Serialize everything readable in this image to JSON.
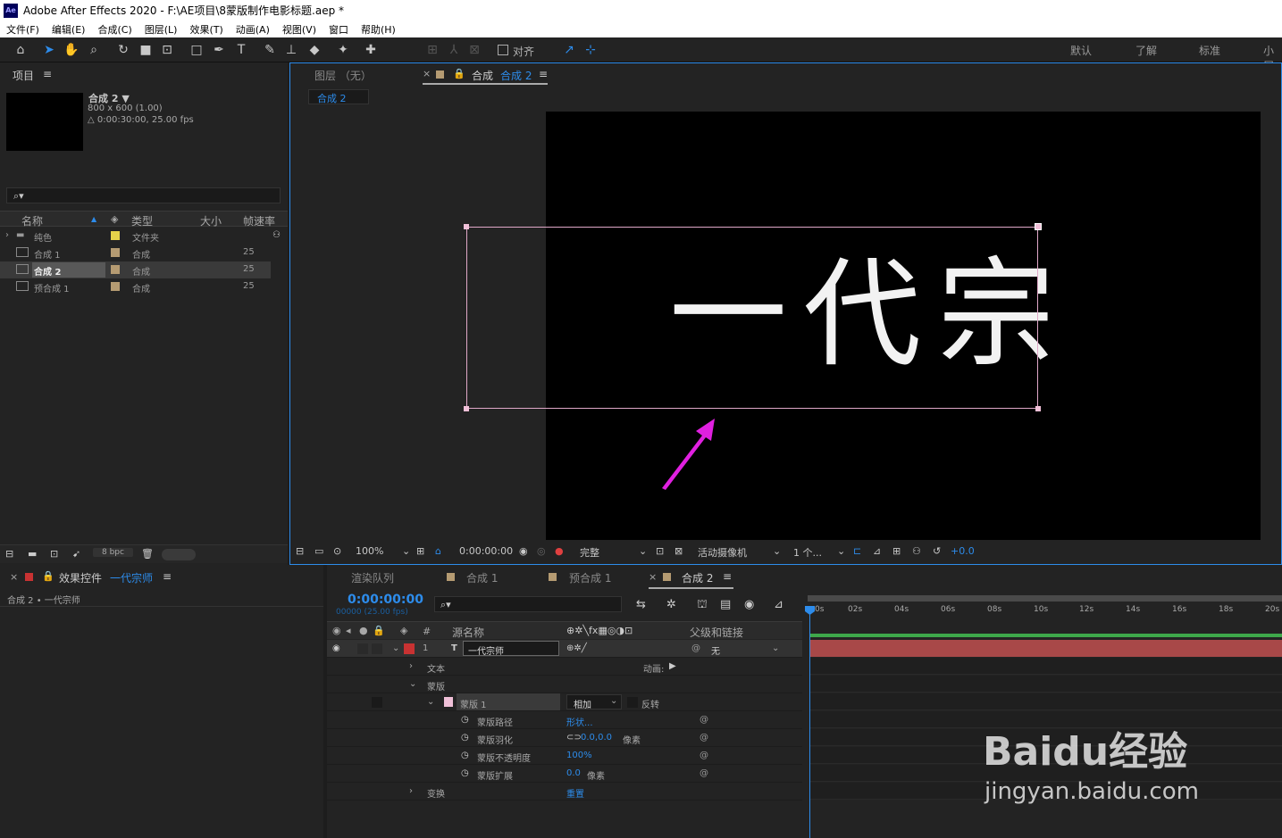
{
  "app": {
    "title": "Adobe After Effects 2020 - F:\\AE项目\\8蒙版制作电影标题.aep *",
    "logo": "Ae"
  },
  "menu": [
    "文件(F)",
    "编辑(E)",
    "合成(C)",
    "图层(L)",
    "效果(T)",
    "动画(A)",
    "视图(V)",
    "窗口",
    "帮助(H)"
  ],
  "toolbar": {
    "snap_label": "对齐",
    "workspaces": [
      "默认",
      "了解",
      "标准",
      "小屏"
    ]
  },
  "project": {
    "title": "项目",
    "comp_name": "合成 2 ▼",
    "comp_size": "800 x 600 (1.00)",
    "comp_duration": "△ 0:00:30:00, 25.00 fps",
    "search_placeholder": "⌕▾",
    "columns": [
      "名称",
      "类型",
      "大小",
      "帧速率"
    ],
    "bpc": "8 bpc",
    "items": [
      {
        "name": "纯色",
        "type": "文件夹",
        "fps": "",
        "color": "#e6d34a"
      },
      {
        "name": "合成 1",
        "type": "合成",
        "fps": "25",
        "color": "#b59b72"
      },
      {
        "name": "合成 2",
        "type": "合成",
        "fps": "25",
        "color": "#b59b72"
      },
      {
        "name": "预合成 1",
        "type": "合成",
        "fps": "25",
        "color": "#b59b72"
      }
    ]
  },
  "viewer": {
    "layer_tab": "图层 （无）",
    "comp_tab_prefix": "合成",
    "comp_tab_name": "合成 2",
    "breadcrumb": "合成 2",
    "title_text": "一代宗",
    "bottom": {
      "zoom": "100%",
      "timecode": "0:00:00:00",
      "quality": "完整",
      "camera": "活动摄像机",
      "views": "1 个...",
      "exposure": "+0.0"
    }
  },
  "effects": {
    "title_prefix": "效果控件",
    "layer": "一代宗师",
    "breadcrumb": "合成 2 • 一代宗师"
  },
  "timeline": {
    "tabs": [
      "渲染队列",
      "合成 1",
      "预合成 1",
      "合成 2"
    ],
    "timecode": "0:00:00:00",
    "frame_info": "00000 (25.00 fps)",
    "search": "⌕▾",
    "headers": {
      "num": "#",
      "source": "源名称",
      "parent": "父级和链接"
    },
    "ruler": [
      "0s",
      "02s",
      "04s",
      "06s",
      "08s",
      "10s",
      "12s",
      "14s",
      "16s",
      "18s",
      "20s"
    ],
    "layer": {
      "index": "1",
      "type_icon": "T",
      "name": "一代宗师",
      "parent": "无"
    },
    "props": {
      "text": "文本",
      "animate": "动画:",
      "masks": "蒙版",
      "mask1": "蒙版 1",
      "mode": "相加",
      "invert": "反转",
      "path_label": "蒙版路径",
      "path_value": "形状...",
      "feather_label": "蒙版羽化",
      "feather_value": "0.0,0.0",
      "feather_unit": "像素",
      "opacity_label": "蒙版不透明度",
      "opacity_value": "100%",
      "expansion_label": "蒙版扩展",
      "expansion_value": "0.0",
      "expansion_unit": "像素",
      "transform": "变换",
      "reset": "重置"
    }
  },
  "watermark": {
    "brand": "Baidu经验",
    "url": "jingyan.baidu.com"
  }
}
